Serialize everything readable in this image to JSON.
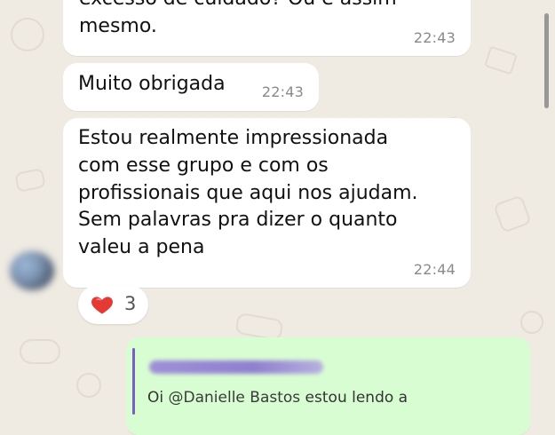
{
  "messages": [
    {
      "text": "excesso de cuidado? Ou é assim\nmesmo.",
      "time": "22:43"
    },
    {
      "text": "Muito obrigada",
      "time": "22:43"
    },
    {
      "text": "Estou realmente impressionada\ncom esse grupo e com os\nprofissionais que aqui nos ajudam.\nSem palavras pra dizer o quanto\nvaleu a pena",
      "time": "22:44"
    }
  ],
  "reaction": {
    "emoji": "❤️",
    "count": "3"
  },
  "reply": {
    "prefix": "Oi ",
    "mention": "@Danielle Bastos",
    "suffix": " estou lendo a"
  },
  "colors": {
    "background": "#efeae2",
    "incoming_bubble": "#ffffff",
    "outgoing_bubble": "#d9fdd3",
    "reply_bar": "#7a5fbf"
  }
}
